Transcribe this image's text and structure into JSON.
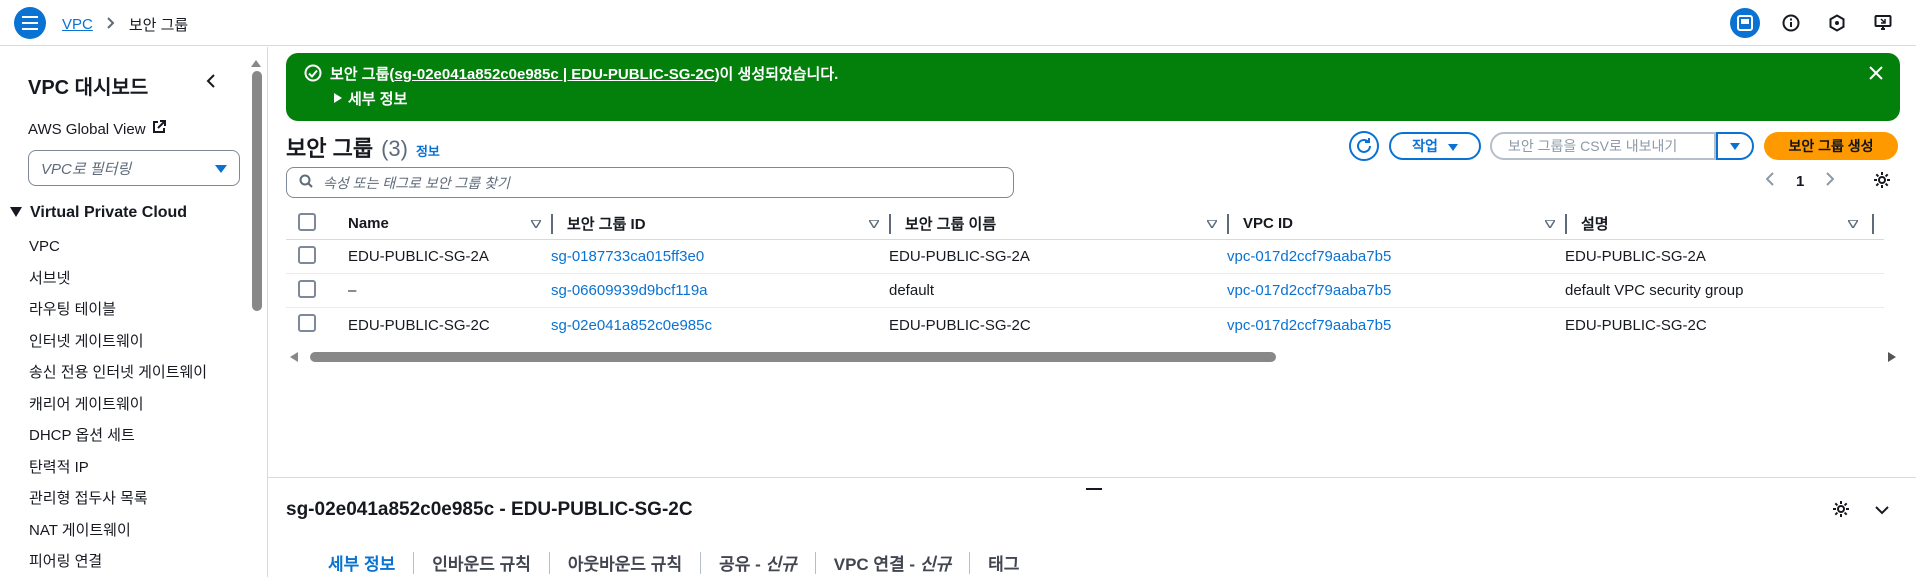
{
  "breadcrumb": {
    "root": "VPC",
    "current": "보안 그룹"
  },
  "sidebar": {
    "title": "VPC 대시보드",
    "global_view": "AWS Global View",
    "filter_placeholder": "VPC로 필터링",
    "section": "Virtual Private Cloud",
    "items": [
      "VPC",
      "서브넷",
      "라우팅 테이블",
      "인터넷 게이트웨이",
      "송신 전용 인터넷 게이트웨이",
      "캐리어 게이트웨이",
      "DHCP 옵션 세트",
      "탄력적 IP",
      "관리형 접두사 목록",
      "NAT 게이트웨이",
      "피어링 연결"
    ]
  },
  "flash": {
    "prefix": "보안 그룹(",
    "link": "sg-02e041a852c0e985c | EDU-PUBLIC-SG-2C",
    "suffix": ")이 생성되었습니다.",
    "detail": "세부 정보"
  },
  "header": {
    "title": "보안 그룹",
    "count": "(3)",
    "info": "정보",
    "actions_label": "작업",
    "csv_label": "보안 그룹을 CSV로 내보내기",
    "create_label": "보안 그룹 생성",
    "search_placeholder": "속성 또는 태그로 보안 그룹 찾기",
    "page": "1"
  },
  "table": {
    "columns": [
      "Name",
      "보안 그룹 ID",
      "보안 그룹 이름",
      "VPC ID",
      "설명"
    ],
    "rows": [
      {
        "name": "EDU-PUBLIC-SG-2A",
        "id": "sg-0187733ca015ff3e0",
        "group_name": "EDU-PUBLIC-SG-2A",
        "vpc": "vpc-017d2ccf79aaba7b5",
        "desc": "EDU-PUBLIC-SG-2A"
      },
      {
        "name": "–",
        "id": "sg-06609939d9bcf119a",
        "group_name": "default",
        "vpc": "vpc-017d2ccf79aaba7b5",
        "desc": "default VPC security group"
      },
      {
        "name": "EDU-PUBLIC-SG-2C",
        "id": "sg-02e041a852c0e985c",
        "group_name": "EDU-PUBLIC-SG-2C",
        "vpc": "vpc-017d2ccf79aaba7b5",
        "desc": "EDU-PUBLIC-SG-2C"
      }
    ]
  },
  "details": {
    "title": "sg-02e041a852c0e985c - EDU-PUBLIC-SG-2C",
    "tabs": {
      "details": "세부 정보",
      "inbound": "인바운드 규칙",
      "outbound": "아웃바운드 규칙",
      "sharing": "공유 - ",
      "sharing_new": "신규",
      "vpc_assoc": "VPC 연결 - ",
      "vpc_assoc_new": "신규",
      "tags": "태그"
    }
  },
  "colors": {
    "primary": "#0972d3",
    "success": "#037f0c",
    "create": "#ff9900"
  }
}
